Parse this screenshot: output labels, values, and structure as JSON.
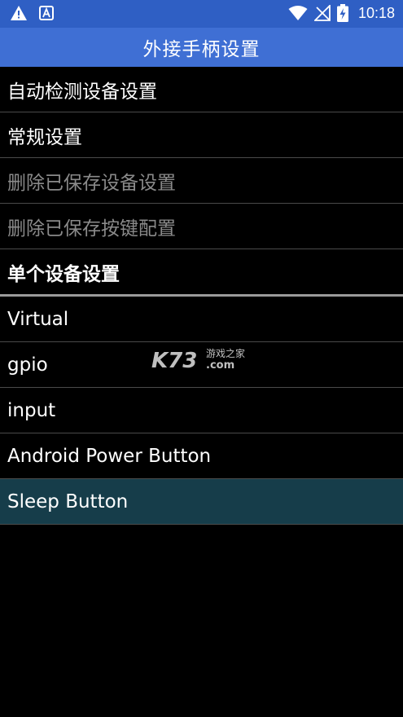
{
  "status_bar": {
    "time": "10:18",
    "icons": [
      "warning-icon",
      "a-box-icon",
      "wifi-icon",
      "no-signal-icon",
      "battery-charging-icon"
    ]
  },
  "app_bar": {
    "title": "外接手柄设置"
  },
  "menu": {
    "items": [
      {
        "label": "自动检测设备设置",
        "enabled": true
      },
      {
        "label": "常规设置",
        "enabled": true
      },
      {
        "label": "删除已保存设备设置",
        "enabled": false
      },
      {
        "label": "删除已保存按键配置",
        "enabled": false
      }
    ]
  },
  "devices": {
    "header": "单个设备设置",
    "items": [
      {
        "label": "Virtual",
        "selected": false
      },
      {
        "label": "gpio",
        "selected": false
      },
      {
        "label": "input",
        "selected": false
      },
      {
        "label": "Android Power Button",
        "selected": false
      },
      {
        "label": "Sleep Button",
        "selected": true
      }
    ]
  },
  "watermark": {
    "brand": "K73",
    "tagline": "游戏之家",
    "domain": ".com"
  },
  "colors": {
    "status_bar": "#2f5fc4",
    "app_bar": "#3f6fd4",
    "selected_row": "#163d4a",
    "disabled_text": "#8a8a8a"
  }
}
